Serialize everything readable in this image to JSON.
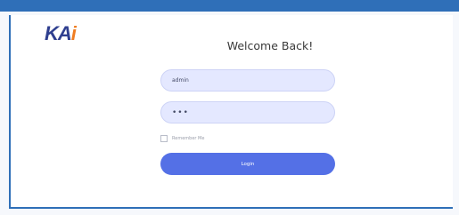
{
  "brand": {
    "logo_main": "KA",
    "logo_accent": "i",
    "primary_color": "#2f6fb8",
    "logo_color": "#2f3f8f",
    "accent_color": "#ef7d22"
  },
  "form": {
    "title": "Welcome Back!",
    "username_value": "admin",
    "password_value": "•••",
    "remember_label": "Remember Me",
    "remember_checked": false,
    "login_label": "Login",
    "button_color": "#5470e6",
    "input_bg": "#e4e8ff"
  }
}
